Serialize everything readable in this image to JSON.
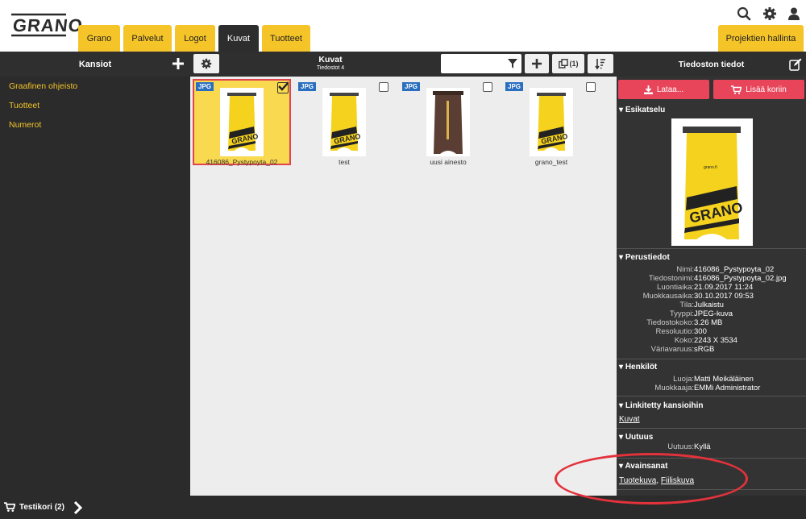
{
  "header": {
    "logo_text": "GRANO",
    "tabs": [
      {
        "label": "Grano"
      },
      {
        "label": "Palvelut"
      },
      {
        "label": "Logot"
      },
      {
        "label": "Kuvat"
      },
      {
        "label": "Tuotteet"
      }
    ],
    "active_tab": "Kuvat",
    "project_button": "Projektien hallinta",
    "icons": [
      "search-icon",
      "gear-icon",
      "user-icon"
    ]
  },
  "toolbar": {
    "folders_title": "Kansiot",
    "center_title": "Kuvat",
    "center_subtitle": "Tiedostot 4",
    "search_value": "",
    "copy_count": "(1)",
    "details_title": "Tiedoston tiedot"
  },
  "folders": [
    {
      "label": "Graafinen ohjeisto"
    },
    {
      "label": "Tuotteet"
    },
    {
      "label": "Numerot"
    }
  ],
  "files": [
    {
      "badge": "JPG",
      "name": "416086_Pystypoyta_02",
      "selected": true
    },
    {
      "badge": "JPG",
      "name": "test",
      "selected": false
    },
    {
      "badge": "JPG",
      "name": "uusi ainesto",
      "selected": false
    },
    {
      "badge": "JPG",
      "name": "grano_test",
      "selected": false
    }
  ],
  "details": {
    "download_label": "Lataa...",
    "cart_label": "Lisää koriin",
    "preview_title": "Esikatselu",
    "basic_title": "Perustiedot",
    "basic": [
      {
        "k": "Nimi:",
        "v": "416086_Pystypoyta_02"
      },
      {
        "k": "Tiedostonimi:",
        "v": "416086_Pystypoyta_02.jpg"
      },
      {
        "k": "Luontiaika:",
        "v": "21.09.2017 11:24"
      },
      {
        "k": "Muokkausaika:",
        "v": "30.10.2017 09:53"
      },
      {
        "k": "Tila:",
        "v": "Julkaistu"
      },
      {
        "k": "Tyyppi:",
        "v": "JPEG-kuva"
      },
      {
        "k": "Tiedostokoko:",
        "v": "3.26 MB"
      },
      {
        "k": "Resoluutio:",
        "v": "300"
      },
      {
        "k": "Koko:",
        "v": "2243 X 3534"
      },
      {
        "k": "Väriavaruus:",
        "v": "sRGB"
      }
    ],
    "persons_title": "Henkilöt",
    "persons": [
      {
        "k": "Luoja:",
        "v": "Matti Meikäläinen"
      },
      {
        "k": "Muokkaaja:",
        "v": "EMMi Administrator"
      }
    ],
    "linked_title": "Linkitetty kansioihin",
    "linked_folder": "Kuvat",
    "news_title": "Uutuus",
    "news_key": "Uutuus:",
    "news_value": "Kyllä",
    "keywords_title": "Avainsanat",
    "keywords": [
      "Tuotekuva",
      "Fiiliskuva"
    ],
    "keyword_separator": ","
  },
  "footer": {
    "cart_label": "Testikori (2)"
  },
  "colors": {
    "accent_yellow": "#f5c428",
    "dark": "#2b2b2b",
    "button_red": "#e8445a",
    "badge_blue": "#2a6fbf",
    "annotation_red": "#e3323b"
  }
}
